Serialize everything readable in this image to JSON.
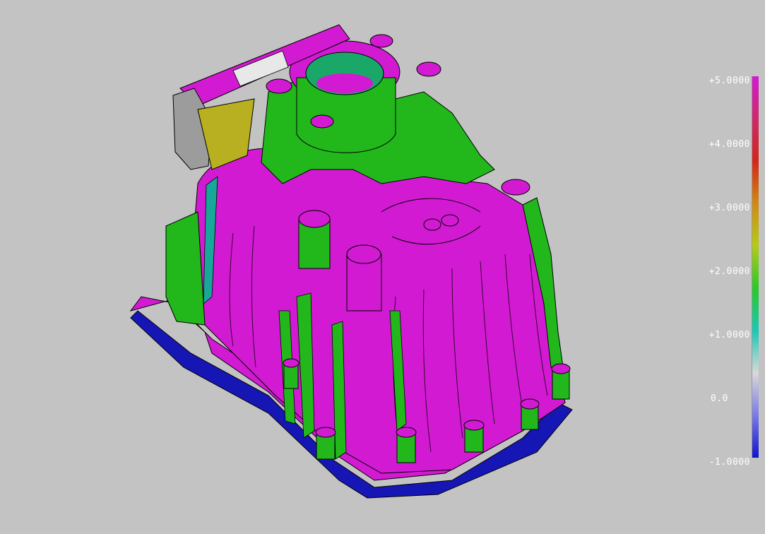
{
  "legend": {
    "labels": [
      "+5.0000",
      "+4.0000",
      "+3.0000",
      "+2.0000",
      "+1.0000",
      "0.0",
      "-1.0000"
    ],
    "gradient_stops": [
      "#d21ad2",
      "#cc2a6a",
      "#d2261a",
      "#d08a14",
      "#b4cc14",
      "#2ac82a",
      "#1ac8b4",
      "#d9d9d9",
      "#7a7ae6",
      "#1414c8"
    ]
  },
  "colors": {
    "background": "#c3c3c3",
    "surface_magenta": "#d21ad2",
    "surface_green": "#22b81c",
    "surface_blue": "#1616b4",
    "surface_gray": "#9c9c9c",
    "surface_yellow": "#b8b020",
    "surface_teal": "#18a89a"
  }
}
